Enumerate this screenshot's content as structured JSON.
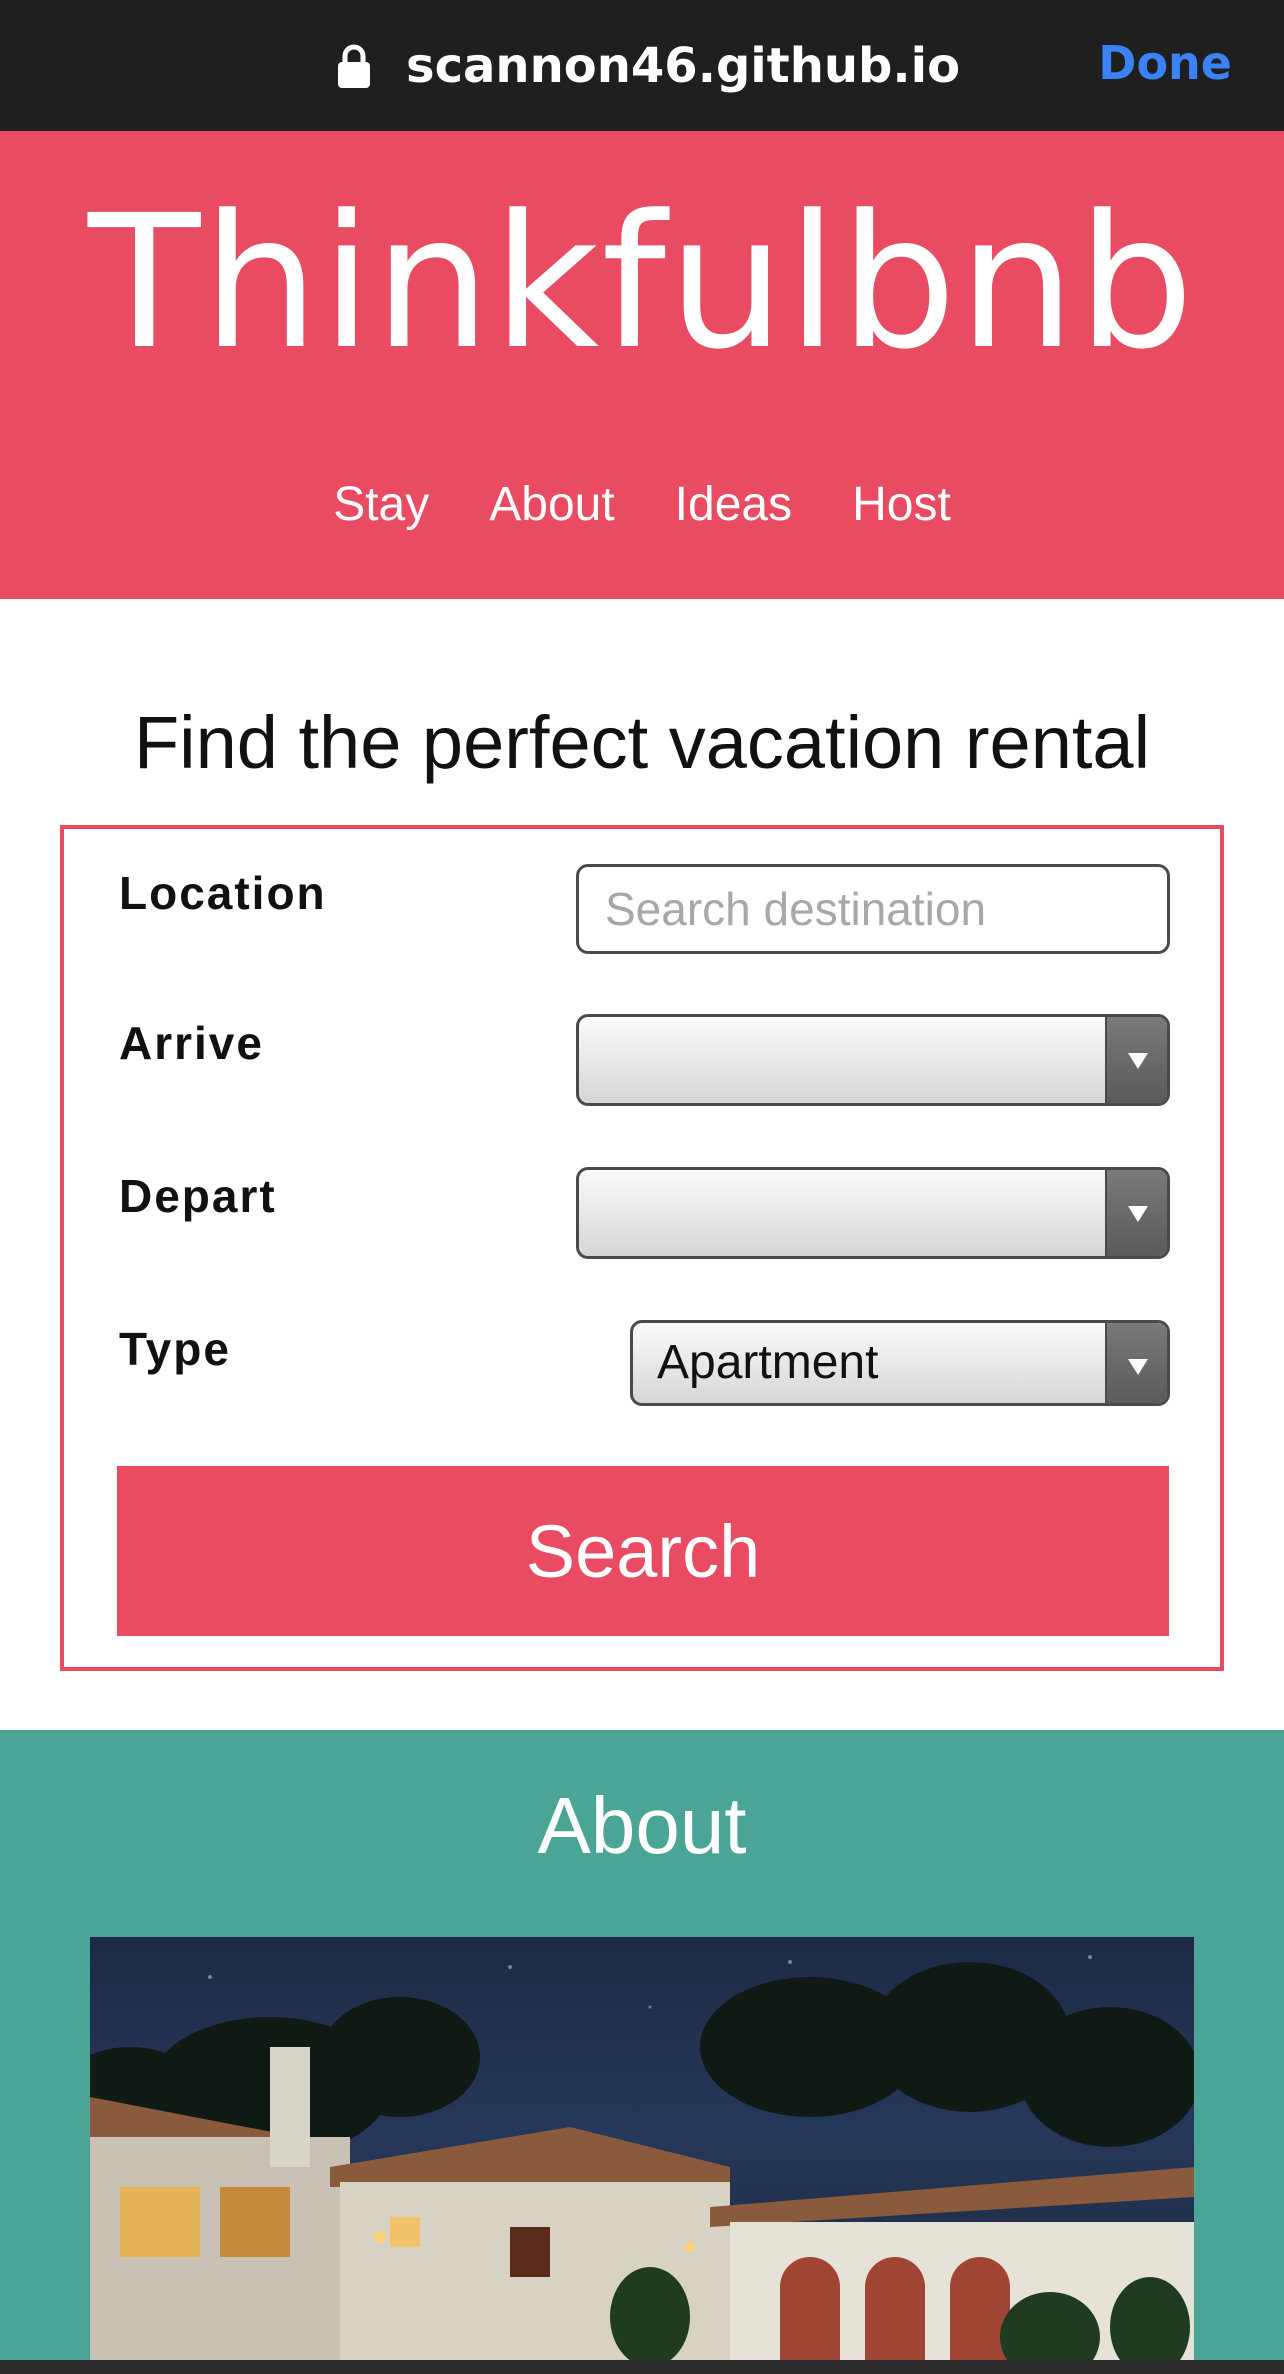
{
  "browser": {
    "url": "scannon46.github.io",
    "done_label": "Done"
  },
  "header": {
    "logo": "Thinkfulbnb",
    "nav": [
      {
        "label": "Stay"
      },
      {
        "label": "About"
      },
      {
        "label": "Ideas"
      },
      {
        "label": "Host"
      }
    ]
  },
  "search": {
    "title": "Find the perfect vacation rental",
    "location_label": "Location",
    "location_placeholder": "Search destination",
    "location_value": "",
    "arrive_label": "Arrive",
    "arrive_value": "",
    "depart_label": "Depart",
    "depart_value": "",
    "type_label": "Type",
    "type_value": "Apartment",
    "button_label": "Search"
  },
  "about": {
    "title": "About"
  },
  "colors": {
    "brand": "#e94b62",
    "about_bg": "#4ba597",
    "browser_bar": "#1f1f1f",
    "done_link": "#3b82f6"
  }
}
